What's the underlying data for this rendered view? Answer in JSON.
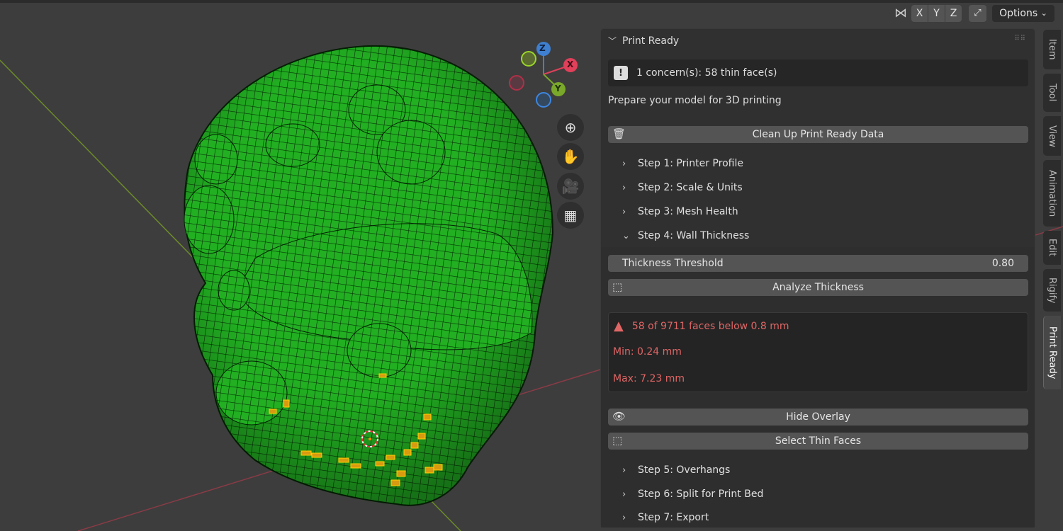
{
  "header": {
    "axes": [
      "X",
      "Y",
      "Z"
    ],
    "options_label": "Options"
  },
  "gizmo": {
    "x": "X",
    "y": "Y",
    "z": "Z"
  },
  "panel": {
    "title": "Print Ready",
    "concern": "1 concern(s): 58 thin face(s)",
    "subtitle": "Prepare your model for 3D printing",
    "cleanup_label": "Clean Up Print Ready Data",
    "steps_before": [
      "Step 1: Printer Profile",
      "Step 2: Scale & Units",
      "Step 3: Mesh Health"
    ],
    "step4": "Step 4: Wall Thickness",
    "threshold_label": "Thickness Threshold",
    "threshold_value": "0.80",
    "analyze_label": "Analyze Thickness",
    "result_warning": "58 of 9711 faces below 0.8 mm",
    "result_min": "Min: 0.24 mm",
    "result_max": "Max: 7.23 mm",
    "hide_overlay_label": "Hide Overlay",
    "select_thin_label": "Select Thin Faces",
    "steps_after": [
      "Step 5: Overhangs",
      "Step 6: Split for Print Bed",
      "Step 7: Export"
    ]
  },
  "sidebar_tabs": [
    "Item",
    "Tool",
    "View",
    "Animation",
    "Edit",
    "Rigify",
    "Print Ready"
  ],
  "colors": {
    "mesh": "#1fae1f",
    "warning": "#e06666",
    "panel": "#303030",
    "viewport": "#3d3d3d"
  }
}
